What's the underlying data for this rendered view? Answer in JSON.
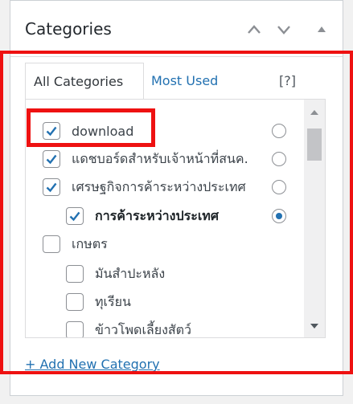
{
  "panel": {
    "title": "Categories",
    "move_up_icon": "chevron-up-icon",
    "move_down_icon": "chevron-down-icon",
    "toggle_icon": "triangle-up-icon"
  },
  "tabs": {
    "all_label": "All Categories",
    "most_used_label": "Most Used",
    "help_label": "[?]"
  },
  "categories": [
    {
      "label": "download",
      "checked": true,
      "primary": false,
      "level": 0
    },
    {
      "label": "แดชบอร์ดสำหรับเจ้าหน้าที่สนค.",
      "checked": true,
      "primary": false,
      "level": 0
    },
    {
      "label": "เศรษฐกิจการค้าระหว่างประเทศ",
      "checked": true,
      "primary": false,
      "level": 0
    },
    {
      "label": "การค้าระหว่างประเทศ",
      "checked": true,
      "primary": true,
      "level": 1
    },
    {
      "label": "เกษตร",
      "checked": false,
      "primary": null,
      "level": 0
    },
    {
      "label": "มันสำปะหลัง",
      "checked": false,
      "primary": null,
      "level": 1
    },
    {
      "label": "ทุเรียน",
      "checked": false,
      "primary": null,
      "level": 1
    },
    {
      "label": "ข้าวโพดเลี้ยงสัตว์",
      "checked": false,
      "primary": null,
      "level": 1
    }
  ],
  "add_new_label": "+ Add New Category",
  "colors": {
    "accent": "#2271b1",
    "highlight": "#ee1111",
    "border": "#dcdcde"
  }
}
